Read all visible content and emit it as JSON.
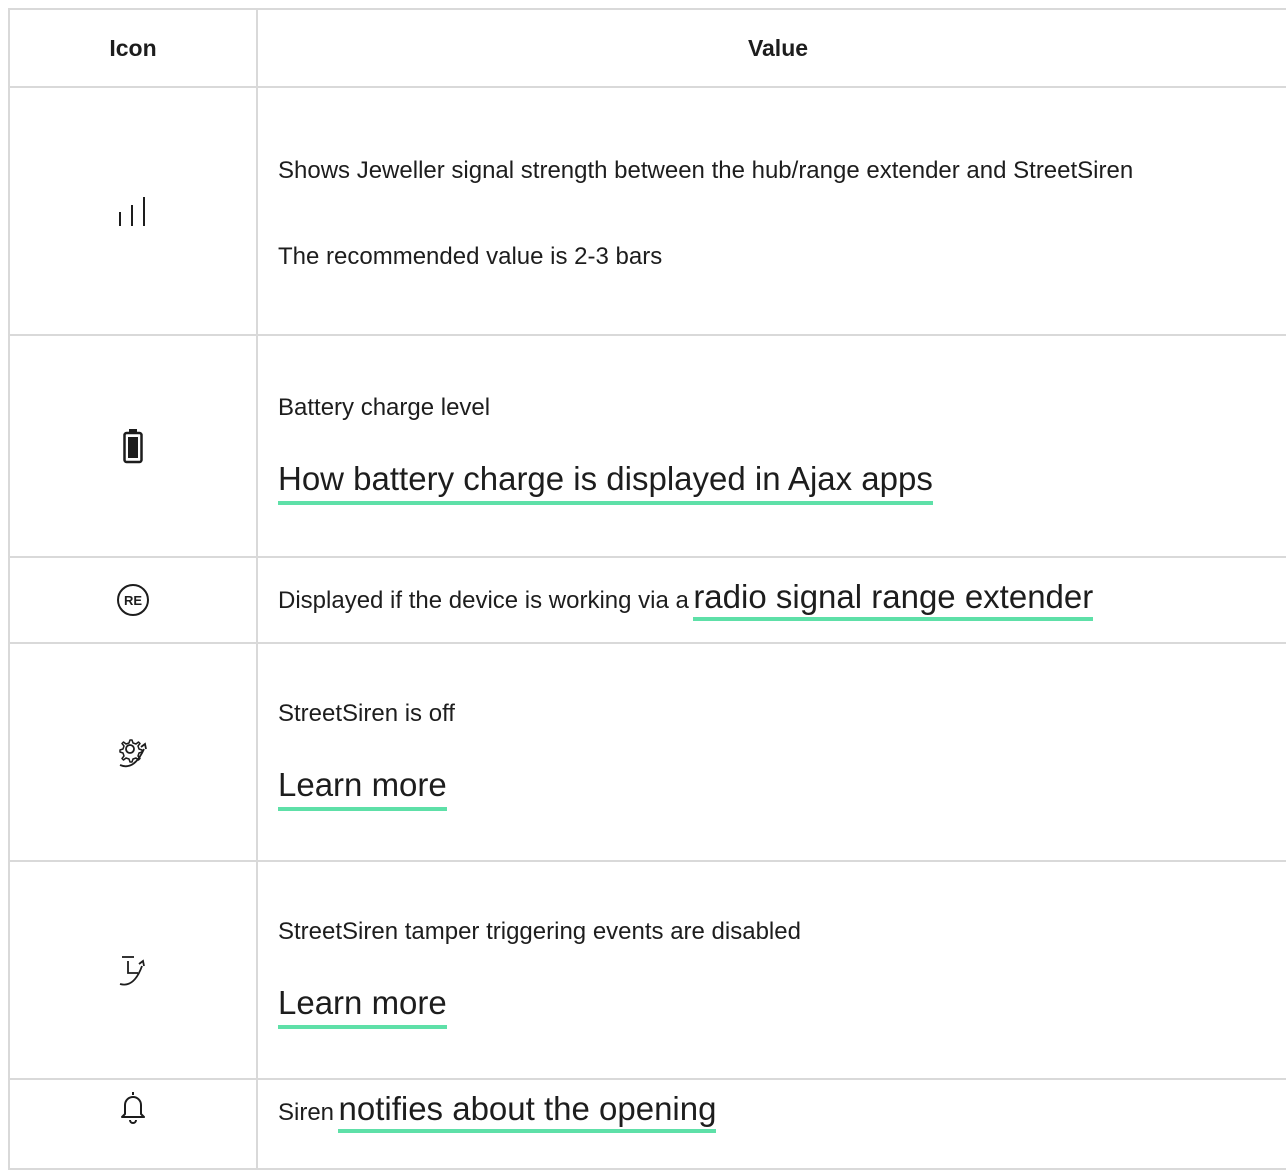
{
  "header": {
    "icon_col": "Icon",
    "value_col": "Value"
  },
  "rows": [
    {
      "icon": "signal-bars-icon",
      "lines": [
        "Shows Jeweller signal strength between the hub/range extender and StreetSiren",
        "The recommended value is 2-3 bars"
      ]
    },
    {
      "icon": "battery-icon",
      "text": "Battery charge level",
      "link": "How battery charge is displayed in Ajax apps"
    },
    {
      "icon": "range-extender-icon",
      "icon_text": "RE",
      "text": "Displayed if the device is working via a",
      "link": "radio signal range extender"
    },
    {
      "icon": "siren-off-gear-icon",
      "text": "StreetSiren is off",
      "link": "Learn more"
    },
    {
      "icon": "tamper-disabled-icon",
      "text": "StreetSiren tamper triggering events are disabled",
      "link": "Learn more"
    },
    {
      "icon": "bell-icon",
      "text": "Siren",
      "link": "notifies about the opening"
    }
  ],
  "colors": {
    "link_underline": "#5ee0a8",
    "border": "#d9d9d9",
    "text": "#1d1d1d"
  }
}
